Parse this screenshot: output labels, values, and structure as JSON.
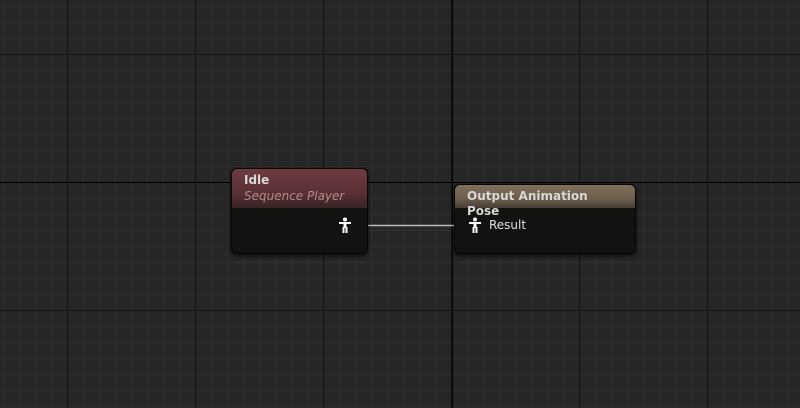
{
  "graph": {
    "background_color": "#262626",
    "nodes": {
      "idle": {
        "title": "Idle",
        "subtitle": "Sequence Player",
        "header_color": "#6f3b40",
        "output_pin_icon": "pose-icon"
      },
      "output": {
        "title": "Output Animation Pose",
        "header_color": "#80705c",
        "input_pin_icon": "pose-icon",
        "input_pin_label": "Result"
      }
    },
    "wire_color": "#bdbdbd"
  }
}
